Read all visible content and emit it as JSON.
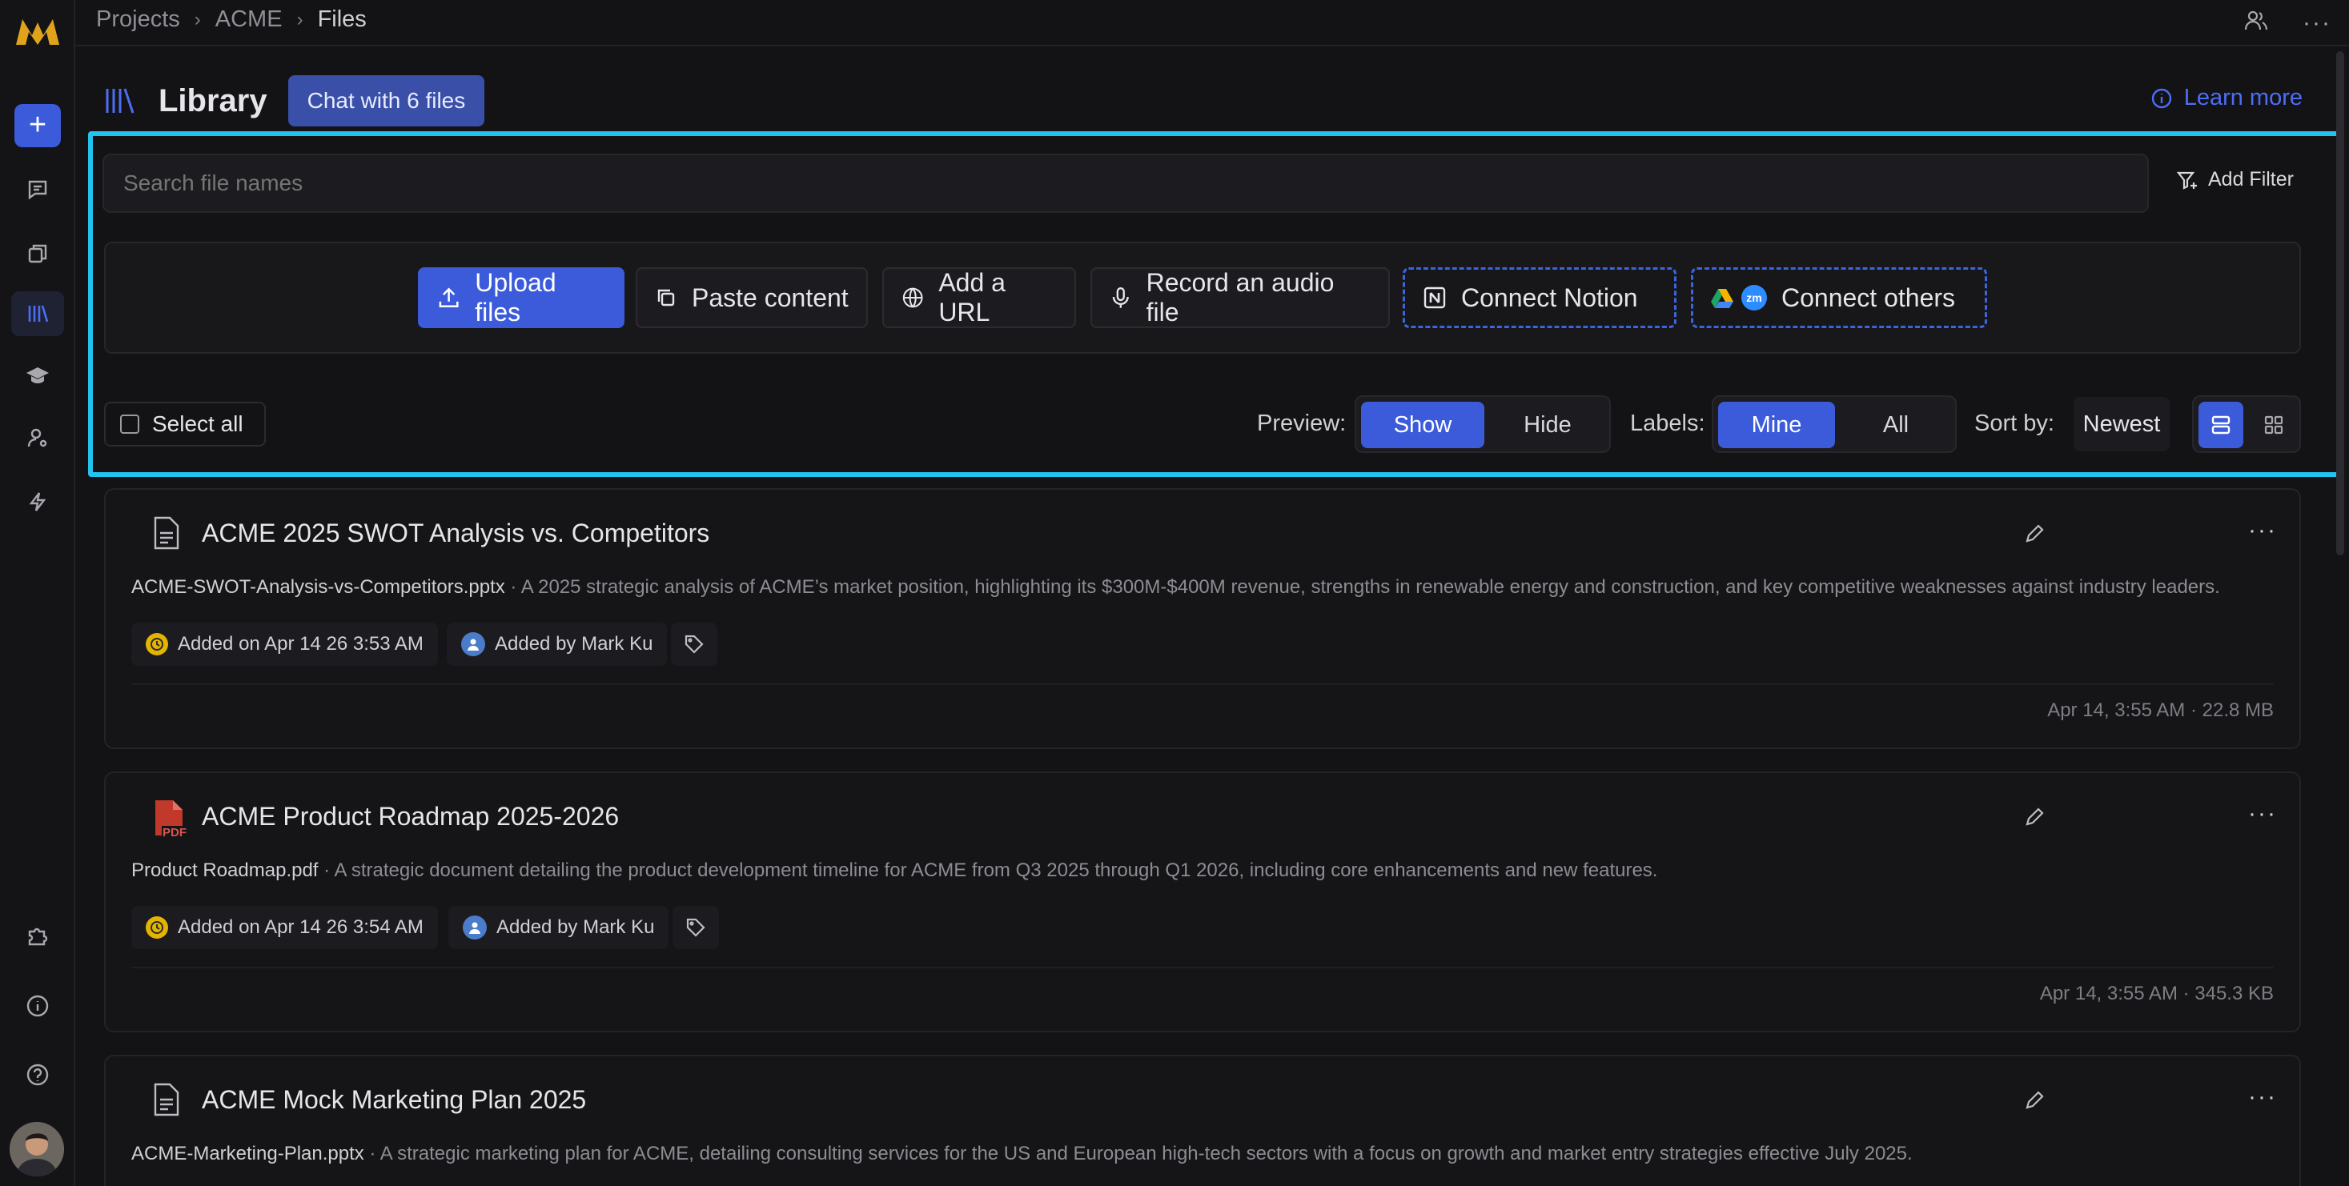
{
  "breadcrumb": [
    "Projects",
    "ACME",
    "Files"
  ],
  "header": {
    "title": "Library",
    "chat_button": "Chat with 6 files",
    "learn_more": "Learn more"
  },
  "search": {
    "placeholder": "Search file names",
    "value": ""
  },
  "add_filter": "Add Filter",
  "actions": {
    "upload": "Upload files",
    "paste": "Paste content",
    "url": "Add a URL",
    "audio": "Record an audio file",
    "notion": "Connect Notion",
    "others": "Connect others"
  },
  "controls": {
    "select_all": "Select all",
    "preview_label": "Preview:",
    "preview_show": "Show",
    "preview_hide": "Hide",
    "labels_label": "Labels:",
    "labels_mine": "Mine",
    "labels_all": "All",
    "sort_label": "Sort by:",
    "sort_value": "Newest"
  },
  "files": [
    {
      "title": "ACME 2025 SWOT Analysis vs. Competitors",
      "filename": "ACME-SWOT-Analysis-vs-Competitors.pptx",
      "description": " · A 2025 strategic analysis of ACME’s market position, highlighting its $300M-$400M revenue, strengths in renewable energy and construction, and key competitive weaknesses against industry leaders.",
      "added_on": "Added on Apr 14 26 3:53 AM",
      "added_by": "Added by Mark Ku",
      "meta": "Apr 14, 3:55 AM · 22.8 MB",
      "type": "document"
    },
    {
      "title": "ACME Product Roadmap 2025-2026",
      "filename": "Product Roadmap.pdf",
      "description": " · A strategic document detailing the product development timeline for ACME from Q3 2025 through Q1 2026, including core enhancements and new features.",
      "added_on": "Added on Apr 14 26 3:54 AM",
      "added_by": "Added by Mark Ku",
      "meta": "Apr 14, 3:55 AM · 345.3 KB",
      "type": "pdf"
    },
    {
      "title": "ACME Mock Marketing Plan 2025",
      "filename": "ACME-Marketing-Plan.pptx",
      "description": " · A strategic marketing plan for ACME, detailing consulting services for the US and European high-tech sectors with a focus on growth and market entry strategies effective July 2025.",
      "type": "document"
    }
  ],
  "colors": {
    "accent": "#3b5bdb",
    "highlight": "#22c3ee",
    "background": "#131316"
  }
}
